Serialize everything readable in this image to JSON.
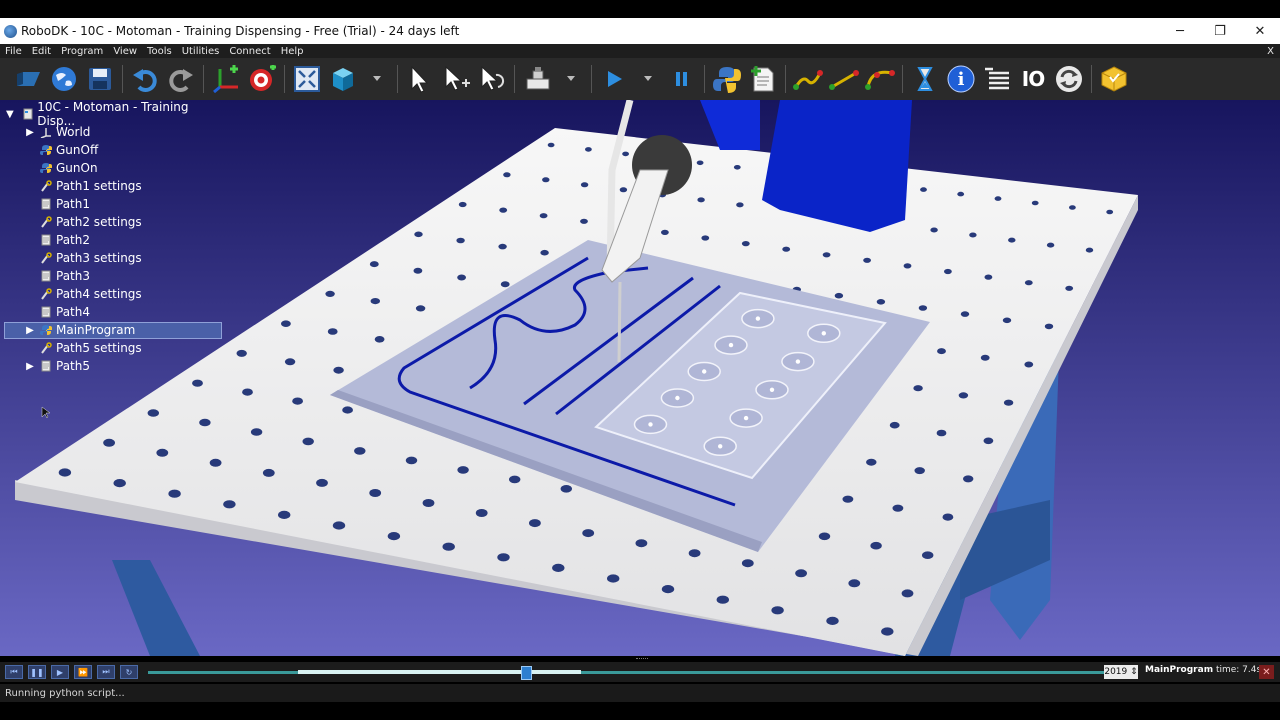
{
  "window": {
    "title": "RoboDK - 10C - Motoman - Training Dispensing - Free (Trial) - 24 days left",
    "minimize": "─",
    "restore": "❐",
    "close": "✕"
  },
  "menubar": {
    "items": [
      "File",
      "Edit",
      "Program",
      "View",
      "Tools",
      "Utilities",
      "Connect",
      "Help"
    ],
    "close": "X"
  },
  "toolbar": {
    "io_label": "IO",
    "icons": [
      "open-icon",
      "web-library-icon",
      "save-icon",
      "undo-icon",
      "redo-icon",
      "add-reference-frame-icon",
      "add-target-icon",
      "fit-all-icon",
      "isometric-view-icon",
      "select-icon",
      "select-move-icon",
      "select-rotate-icon",
      "add-tool-icon",
      "run-icon",
      "pause-icon",
      "python-icon",
      "add-program-icon",
      "move-joint-icon",
      "move-linear-icon",
      "move-circular-icon",
      "wait-icon",
      "info-icon",
      "list-icon",
      "io-icon",
      "refresh-icon",
      "package-icon"
    ]
  },
  "tree": {
    "root": "10C - Motoman - Training Disp...",
    "items": [
      {
        "label": "World",
        "icon": "frame-icon",
        "expandable": true
      },
      {
        "label": "GunOff",
        "icon": "python-script-icon",
        "expandable": false
      },
      {
        "label": "GunOn",
        "icon": "python-script-icon",
        "expandable": false
      },
      {
        "label": "Path1 settings",
        "icon": "settings-icon",
        "expandable": false
      },
      {
        "label": "Path1",
        "icon": "document-icon",
        "expandable": false
      },
      {
        "label": "Path2 settings",
        "icon": "settings-icon",
        "expandable": false
      },
      {
        "label": "Path2",
        "icon": "document-icon",
        "expandable": false
      },
      {
        "label": "Path3 settings",
        "icon": "settings-icon",
        "expandable": false
      },
      {
        "label": "Path3",
        "icon": "document-icon",
        "expandable": false
      },
      {
        "label": "Path4 settings",
        "icon": "settings-icon",
        "expandable": false
      },
      {
        "label": "Path4",
        "icon": "document-icon",
        "expandable": false
      },
      {
        "label": "MainProgram",
        "icon": "python-script-icon",
        "expandable": true,
        "selected": true
      },
      {
        "label": "Path5 settings",
        "icon": "settings-icon",
        "expandable": false
      },
      {
        "label": "Path5",
        "icon": "document-icon",
        "expandable": true
      }
    ]
  },
  "playback": {
    "frame": "2019",
    "program": "MainProgram",
    "time_label": "time: 7.4s",
    "progress": 0.39
  },
  "status": {
    "text": "Running python script..."
  },
  "colors": {
    "background_top": "#17155e",
    "background_bottom": "#6a68c4",
    "table_top": "#f2f2f2",
    "plate": "#b4bad8",
    "path_line": "#0c1aa8",
    "robot": "#0a24c8",
    "selection": "#4a60a8",
    "slider": "#3a9a9a"
  }
}
